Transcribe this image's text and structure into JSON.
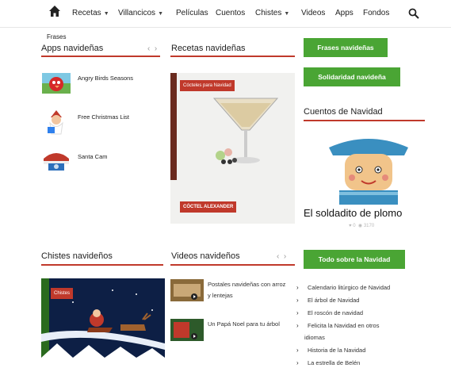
{
  "nav": {
    "items": [
      {
        "label": "Recetas",
        "dropdown": true
      },
      {
        "label": "Villancicos",
        "dropdown": true
      },
      {
        "label": "Películas",
        "dropdown": false
      },
      {
        "label": "Cuentos",
        "dropdown": false
      },
      {
        "label": "Chistes",
        "dropdown": true
      },
      {
        "label": "Videos",
        "dropdown": false
      },
      {
        "label": "Apps",
        "dropdown": false
      },
      {
        "label": "Fondos",
        "dropdown": false
      }
    ],
    "overflow_item": "Frases"
  },
  "apps": {
    "title": "Apps navideñas",
    "items": [
      {
        "label": "Angry Birds Seasons"
      },
      {
        "label": "Free Christmas List"
      },
      {
        "label": "Santa Cam"
      }
    ]
  },
  "recipes": {
    "title": "Recetas navideñas",
    "category_tag": "Cócteles para Navidad",
    "caption": "CÓCTEL ALEXANDER"
  },
  "sidebar": {
    "buttons": [
      {
        "label": "Frases navideñas"
      },
      {
        "label": "Solidaridad navideña"
      }
    ],
    "stories_title": "Cuentos de Navidad",
    "story_title": "El soldadito de plomo",
    "story_likes": "0",
    "story_views": "3170"
  },
  "jokes": {
    "title": "Chistes navideños",
    "tag": "Chistes"
  },
  "videos": {
    "title": "Videos navideños",
    "items": [
      {
        "label_line1": "Postales navideñas con arroz",
        "label_line2": "y lentejas"
      },
      {
        "label_line1": "Un Papá Noel para tu árbol",
        "label_line2": ""
      }
    ]
  },
  "christmas": {
    "button": "Todo sobre la Navidad",
    "links": [
      "Calendario litúrgico de Navidad",
      "El árbol de Navidad",
      "El roscón de navidad",
      "Felicita la Navidad en otros",
      "Historia de la Navidad",
      "La estrella de Belén"
    ],
    "wrap_continuation": "idiomas"
  },
  "colors": {
    "accent_red": "#c0392b",
    "button_green": "#4aa534"
  }
}
